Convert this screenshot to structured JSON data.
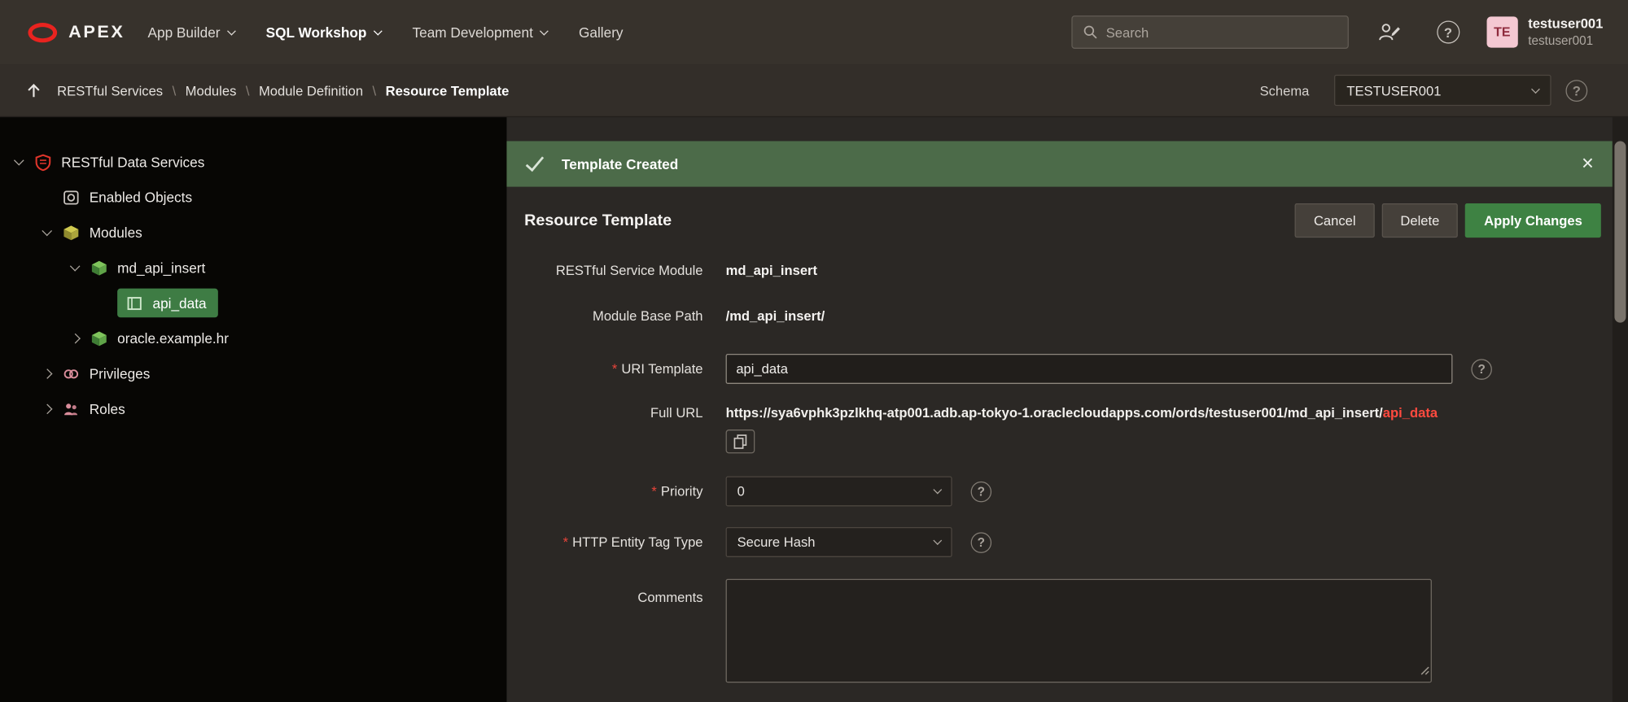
{
  "colors": {
    "banner_green": "#4C6B49",
    "apply_button_green": "#3E8243",
    "tree_selected_green": "#3E7C44",
    "brand_red": "#E9231F",
    "url_highlight_red": "#FF4A3F",
    "avatar_pink": "#F4C8D2"
  },
  "icons": {
    "help": "?",
    "close": "×"
  },
  "nav": {
    "brand": "APEX",
    "items": [
      {
        "label": "App Builder"
      },
      {
        "label": "SQL Workshop"
      },
      {
        "label": "Team Development"
      },
      {
        "label": "Gallery"
      }
    ],
    "search_placeholder": "Search",
    "user": {
      "initials": "TE",
      "name": "testuser001",
      "username": "testuser001"
    }
  },
  "breadcrumb": {
    "separator": "\\",
    "items": [
      "RESTful Services",
      "Modules",
      "Module Definition",
      "Resource Template"
    ],
    "schema_label": "Schema",
    "schema_value": "TESTUSER001"
  },
  "tree": {
    "items": [
      {
        "label": "RESTful Data Services"
      },
      {
        "label": "Enabled Objects"
      },
      {
        "label": "Modules"
      },
      {
        "label": "md_api_insert"
      },
      {
        "label": "api_data"
      },
      {
        "label": "oracle.example.hr"
      },
      {
        "label": "Privileges"
      },
      {
        "label": "Roles"
      }
    ]
  },
  "banner": {
    "message": "Template Created"
  },
  "page": {
    "title": "Resource Template",
    "cancel_label": "Cancel",
    "delete_label": "Delete",
    "apply_label": "Apply Changes"
  },
  "form": {
    "required_marker": "*",
    "rows": {
      "module": {
        "label": "RESTful Service Module",
        "value": "md_api_insert"
      },
      "base_path": {
        "label": "Module Base Path",
        "value": "/md_api_insert/"
      },
      "uri": {
        "label": "URI Template",
        "value": "api_data"
      },
      "full_url": {
        "label": "Full URL",
        "base": "https://sya6vphk3pzlkhq-atp001.adb.ap-tokyo-1.oraclecloudapps.com/ords/testuser001/md_api_insert/",
        "highlight": "api_data"
      },
      "priority": {
        "label": "Priority",
        "value": "0"
      },
      "etag": {
        "label": "HTTP Entity Tag Type",
        "value": "Secure Hash"
      },
      "comments": {
        "label": "Comments",
        "value": ""
      }
    }
  }
}
